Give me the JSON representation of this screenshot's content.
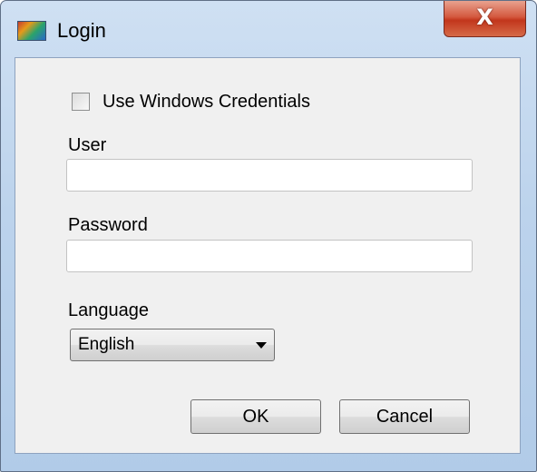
{
  "window": {
    "title": "Login",
    "close_symbol": "X"
  },
  "form": {
    "use_windows_credentials": {
      "label": "Use Windows Credentials",
      "checked": false
    },
    "user": {
      "label": "User",
      "value": "",
      "placeholder": ""
    },
    "password": {
      "label": "Password",
      "value": "",
      "placeholder": ""
    },
    "language": {
      "label": "Language",
      "selected": "English"
    }
  },
  "buttons": {
    "ok_label": "OK",
    "cancel_label": "Cancel"
  },
  "icons": {
    "app": "app-icon",
    "close": "close-icon",
    "dropdown": "chevron-down-icon"
  },
  "colors": {
    "close_button": "#c2361c",
    "window_frame": "#bcd3ec",
    "client_background": "#f0f0f0"
  }
}
